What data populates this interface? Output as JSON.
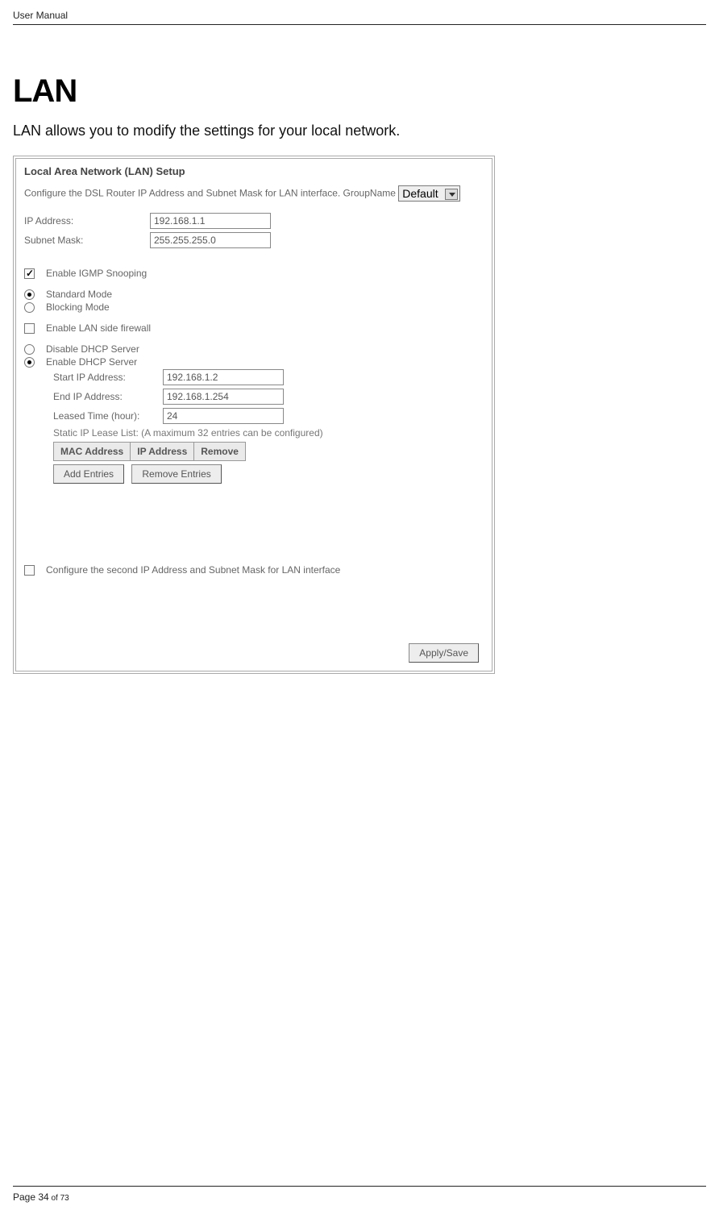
{
  "header": {
    "label": "User Manual"
  },
  "section": {
    "title": "LAN",
    "intro": "LAN allows you to modify the settings for your local network."
  },
  "panel": {
    "title": "Local Area Network (LAN) Setup",
    "desc": "Configure the DSL Router IP Address and Subnet Mask for LAN interface.  GroupName",
    "group_name_value": "Default",
    "ip": {
      "label": "IP Address:",
      "value": "192.168.1.1"
    },
    "mask": {
      "label": "Subnet Mask:",
      "value": "255.255.255.0"
    },
    "igmp": {
      "label": "Enable IGMP Snooping"
    },
    "mode_standard": "Standard Mode",
    "mode_blocking": "Blocking Mode",
    "lan_fw": "Enable LAN side firewall",
    "dhcp_disable": "Disable DHCP Server",
    "dhcp_enable": "Enable DHCP Server",
    "dhcp": {
      "start_label": "Start IP Address:",
      "start_value": "192.168.1.2",
      "end_label": "End IP Address:",
      "end_value": "192.168.1.254",
      "lease_label": "Leased Time (hour):",
      "lease_value": "24",
      "static_note": "Static IP Lease List: (A maximum 32 entries can be configured)",
      "col_mac": "MAC Address",
      "col_ip": "IP Address",
      "col_remove": "Remove",
      "add_btn": "Add Entries",
      "remove_btn": "Remove Entries"
    },
    "second_ip": "Configure the second IP Address and Subnet Mask for LAN interface",
    "apply_btn": "Apply/Save"
  },
  "footer": {
    "page_prefix": "Page 34",
    "page_suffix": " of 73"
  }
}
